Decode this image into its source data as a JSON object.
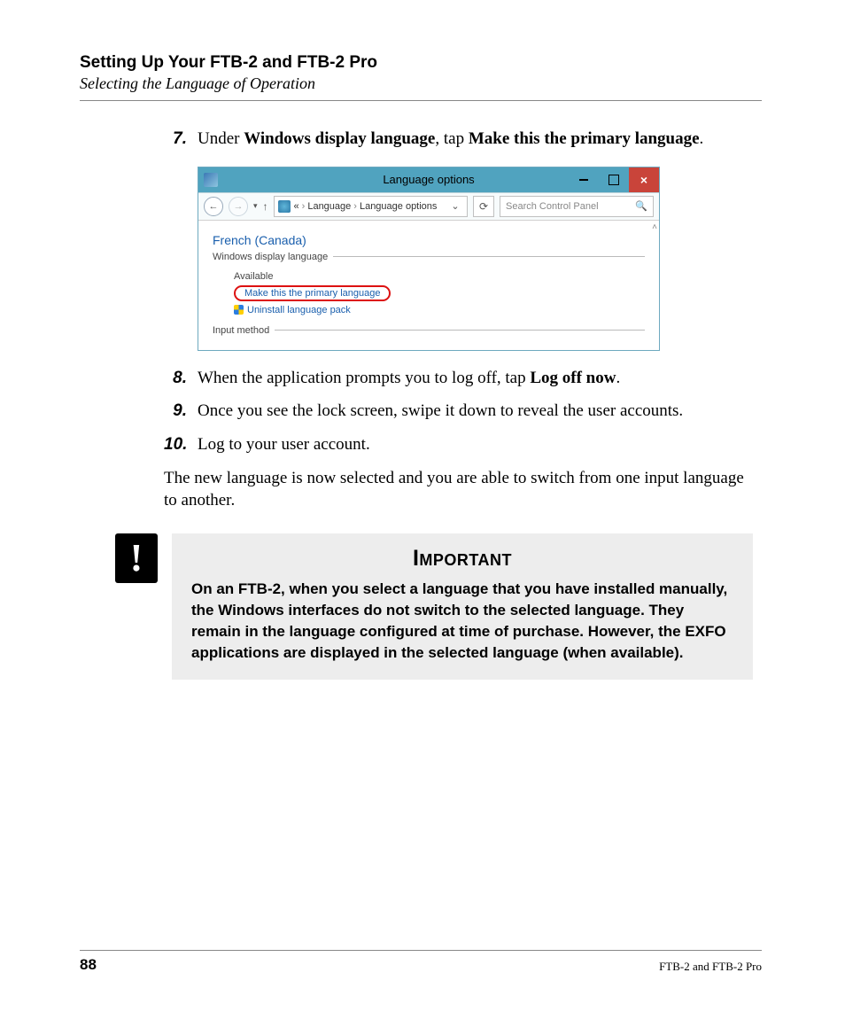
{
  "header": {
    "title": "Setting Up Your FTB-2 and FTB-2 Pro",
    "subtitle": "Selecting the Language of Operation"
  },
  "steps": {
    "s7": {
      "num": "7.",
      "pre": "Under ",
      "bold1": "Windows display language",
      "mid": ", tap ",
      "bold2": "Make this the primary language",
      "post": "."
    },
    "s8": {
      "num": "8.",
      "pre": "When the application prompts you to log off, tap ",
      "bold1": "Log off now",
      "post": "."
    },
    "s9": {
      "num": "9.",
      "text": "Once you see the lock screen, swipe it down to reveal the user accounts."
    },
    "s10": {
      "num": "10.",
      "text": "Log to your user account."
    }
  },
  "closing_para": "The new language is now selected and you are able to switch from one input language to another.",
  "screenshot": {
    "window_title": "Language options",
    "breadcrumb": {
      "root_label": "«",
      "seg1": "Language",
      "seg2": "Language options"
    },
    "search_placeholder": "Search Control Panel",
    "language_heading": "French (Canada)",
    "group1_label": "Windows display language",
    "available_label": "Available",
    "primary_link": "Make this the primary language",
    "uninstall_link": "Uninstall language pack",
    "group2_label": "Input method"
  },
  "important": {
    "title": "Important",
    "body": "On an FTB-2, when you select a language that you have installed manually, the Windows interfaces do not switch to the selected language. They remain in the language configured at time of purchase. However, the EXFO applications are displayed in the selected language (when available)."
  },
  "footer": {
    "page_number": "88",
    "product": "FTB-2 and FTB-2 Pro"
  }
}
